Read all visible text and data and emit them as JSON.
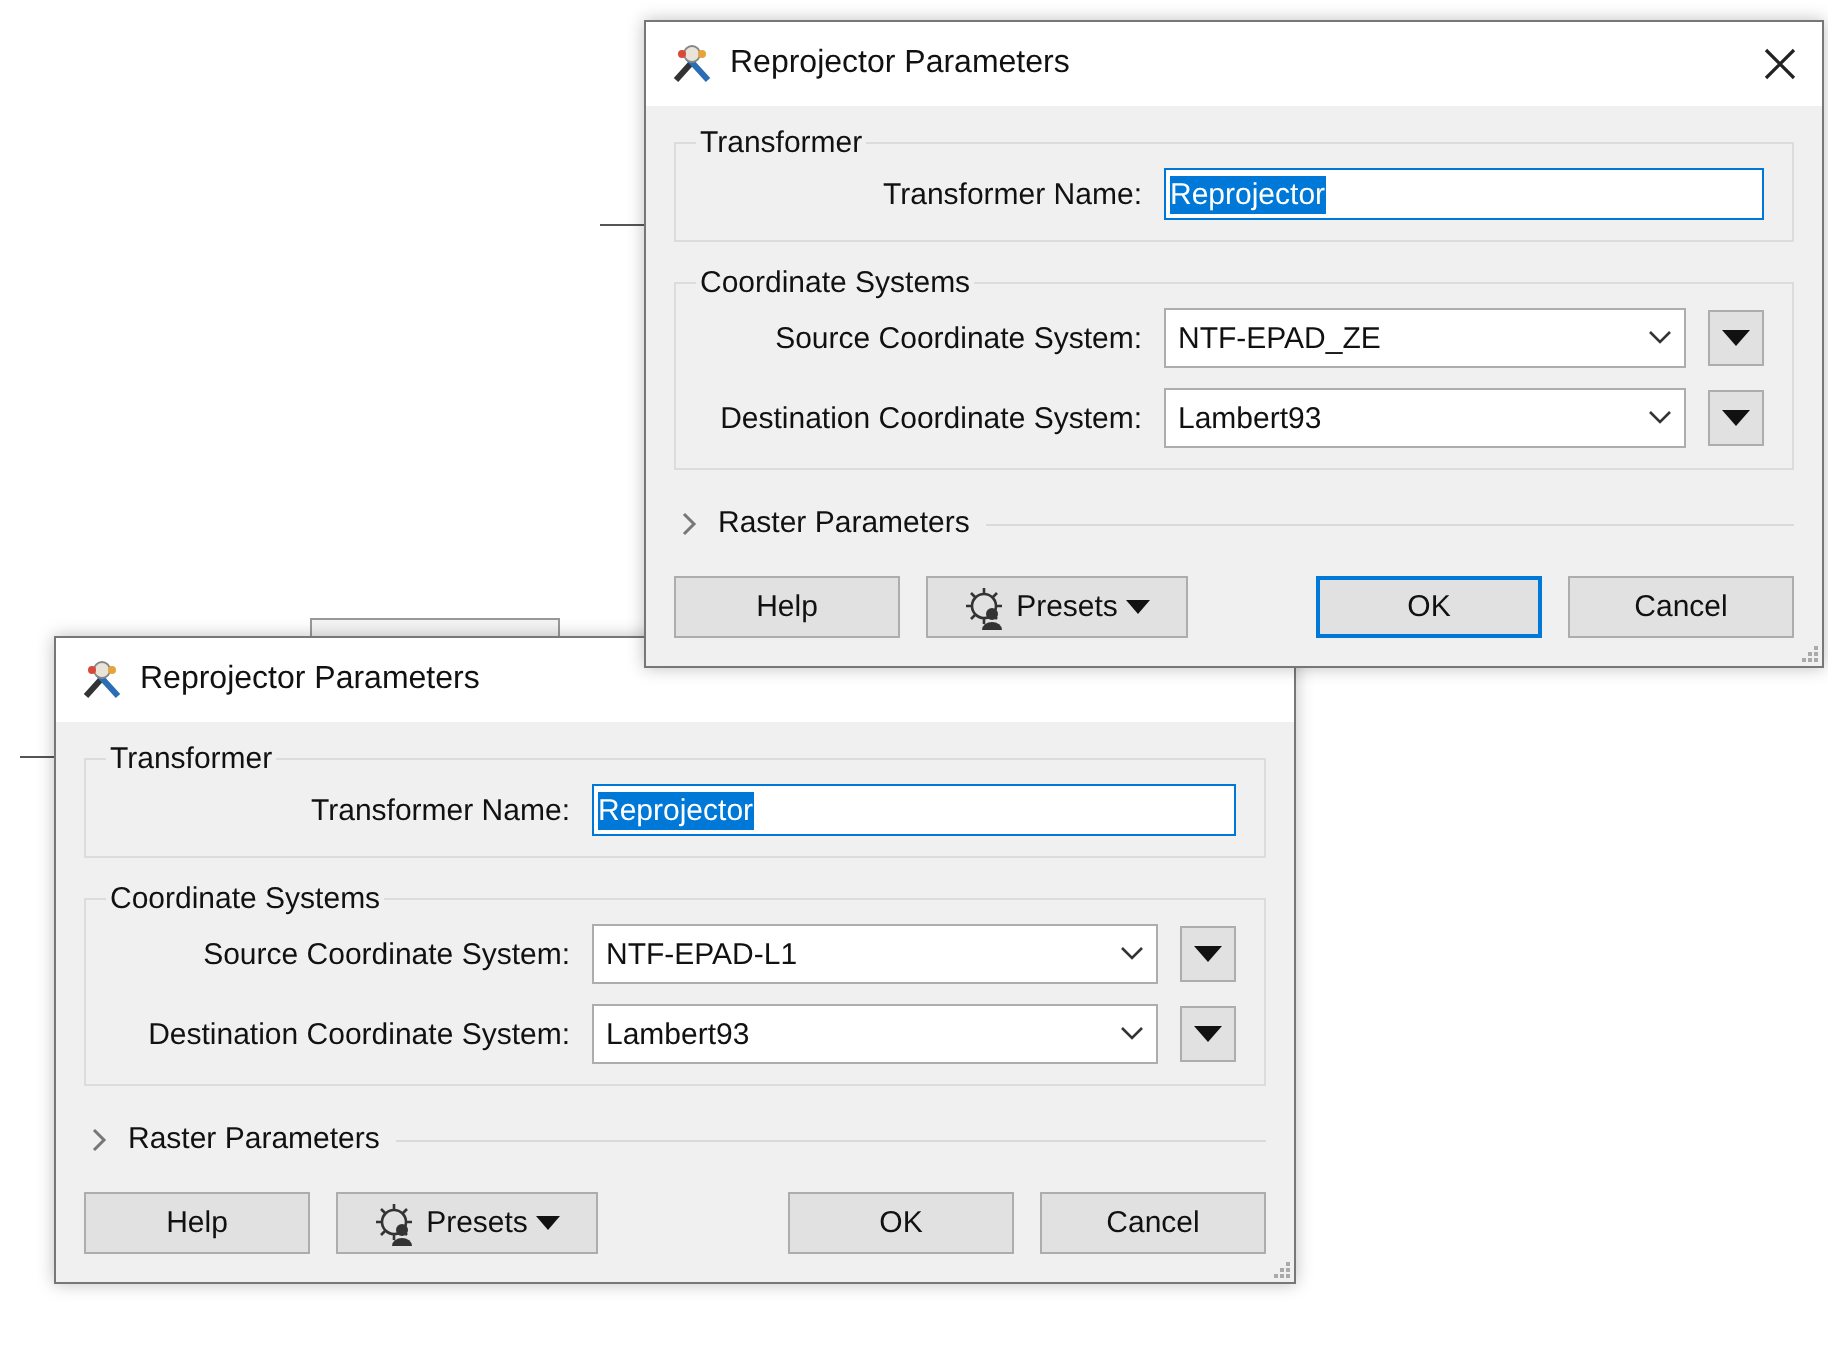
{
  "dialogs": [
    {
      "title": "Reprojector Parameters",
      "close_button": true,
      "groups": [
        {
          "legend": "Transformer",
          "fields": [
            {
              "kind": "text",
              "label": "Transformer Name:",
              "value": "Reprojector",
              "highlighted": true
            }
          ]
        },
        {
          "legend": "Coordinate Systems",
          "fields": [
            {
              "kind": "combo",
              "label": "Source Coordinate System:",
              "value": "NTF-EPAD_ZE"
            },
            {
              "kind": "combo",
              "label": "Destination Coordinate System:",
              "value": "Lambert93"
            }
          ]
        }
      ],
      "section": {
        "label": "Raster Parameters",
        "expanded": false
      },
      "buttons": [
        {
          "kind": "help",
          "label": "Help",
          "default": false
        },
        {
          "kind": "presets",
          "label": "Presets",
          "default": false
        },
        {
          "kind": "ok",
          "label": "OK",
          "default": true
        },
        {
          "kind": "cancel",
          "label": "Cancel",
          "default": false
        }
      ]
    },
    {
      "title": "Reprojector Parameters",
      "close_button": false,
      "groups": [
        {
          "legend": "Transformer",
          "fields": [
            {
              "kind": "text",
              "label": "Transformer Name:",
              "value": "Reprojector",
              "highlighted": true
            }
          ]
        },
        {
          "legend": "Coordinate Systems",
          "fields": [
            {
              "kind": "combo",
              "label": "Source Coordinate System:",
              "value": "NTF-EPAD-L1"
            },
            {
              "kind": "combo",
              "label": "Destination Coordinate System:",
              "value": "Lambert93"
            }
          ]
        }
      ],
      "section": {
        "label": "Raster Parameters",
        "expanded": false
      },
      "buttons": [
        {
          "kind": "help",
          "label": "Help",
          "default": false
        },
        {
          "kind": "presets",
          "label": "Presets",
          "default": false
        },
        {
          "kind": "ok",
          "label": "OK",
          "default": false
        },
        {
          "kind": "cancel",
          "label": "Cancel",
          "default": false
        }
      ]
    }
  ]
}
